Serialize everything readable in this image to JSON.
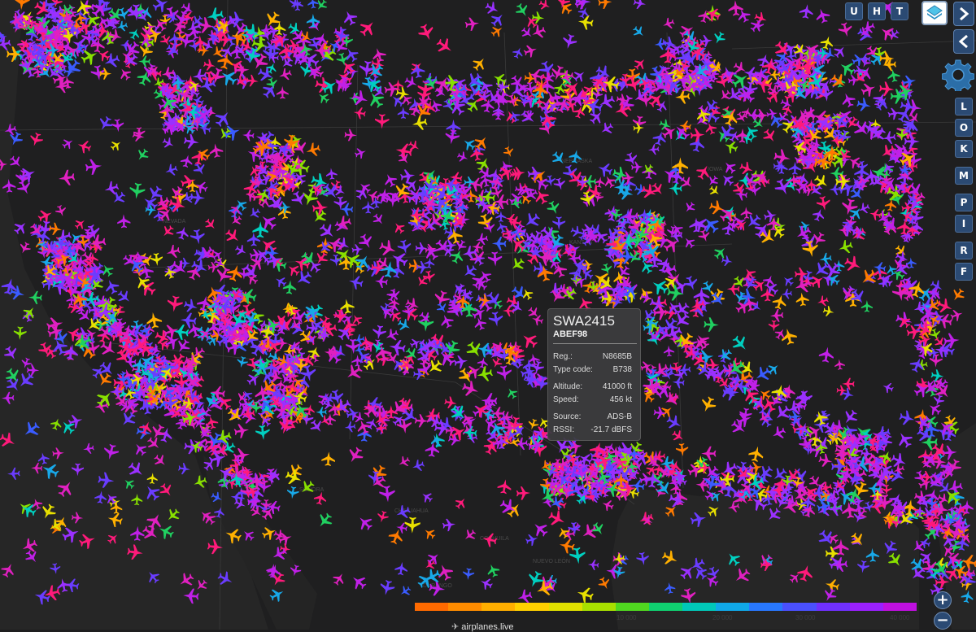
{
  "map": {
    "state_labels": [
      "NEVADA",
      "COLORADO",
      "KANSAS",
      "IOWA",
      "NEBRASKA",
      "WISCONSIN",
      "SONORA",
      "CHIHUAHUA",
      "COAHUILA",
      "NUEVO LEÓN",
      "DURANGO"
    ],
    "plane_colors": [
      "#ff7a00",
      "#ffb000",
      "#e8e000",
      "#88e000",
      "#20d060",
      "#00d0c0",
      "#18a8e8",
      "#3a5cff",
      "#6a3cff",
      "#9a30ff",
      "#c020e8",
      "#e020c0",
      "#ff1a7a"
    ]
  },
  "top_buttons": [
    {
      "label": "U",
      "name": "button-u"
    },
    {
      "label": "H",
      "name": "button-h"
    },
    {
      "label": "T",
      "name": "button-t"
    }
  ],
  "side_buttons": [
    {
      "label": "L",
      "name": "button-l"
    },
    {
      "label": "O",
      "name": "button-o"
    },
    {
      "label": "K",
      "name": "button-k"
    },
    {
      "label": "M",
      "name": "button-m"
    },
    {
      "label": "P",
      "name": "button-p"
    },
    {
      "label": "I",
      "name": "button-i"
    },
    {
      "label": "R",
      "name": "button-r"
    },
    {
      "label": "F",
      "name": "button-f"
    }
  ],
  "infobox": {
    "callsign": "SWA2415",
    "hex": "ABEF98",
    "rows": [
      {
        "label": "Reg.:",
        "value": "N8685B"
      },
      {
        "label": "Type code:",
        "value": "B738"
      },
      {
        "label": "Altitude:",
        "value": "41000 ft"
      },
      {
        "label": "Speed:",
        "value": "456 kt"
      },
      {
        "label": "Source:",
        "value": "ADS-B"
      },
      {
        "label": "RSSI:",
        "value": "-21.7 dBFS"
      }
    ]
  },
  "legend": {
    "colors": [
      "#ff6a00",
      "#ff8c00",
      "#ffae00",
      "#ffd000",
      "#e0e000",
      "#a8e000",
      "#50d820",
      "#10d070",
      "#00c8b8",
      "#10a8e8",
      "#2878ff",
      "#4a50ff",
      "#7030ff",
      "#9a20ff",
      "#c010e0"
    ],
    "tick_labels": [
      "10 000",
      "20 000",
      "30 000",
      "40 000"
    ]
  },
  "zoom": {
    "in": "+",
    "out": "−"
  },
  "credit": "airplanes.live"
}
